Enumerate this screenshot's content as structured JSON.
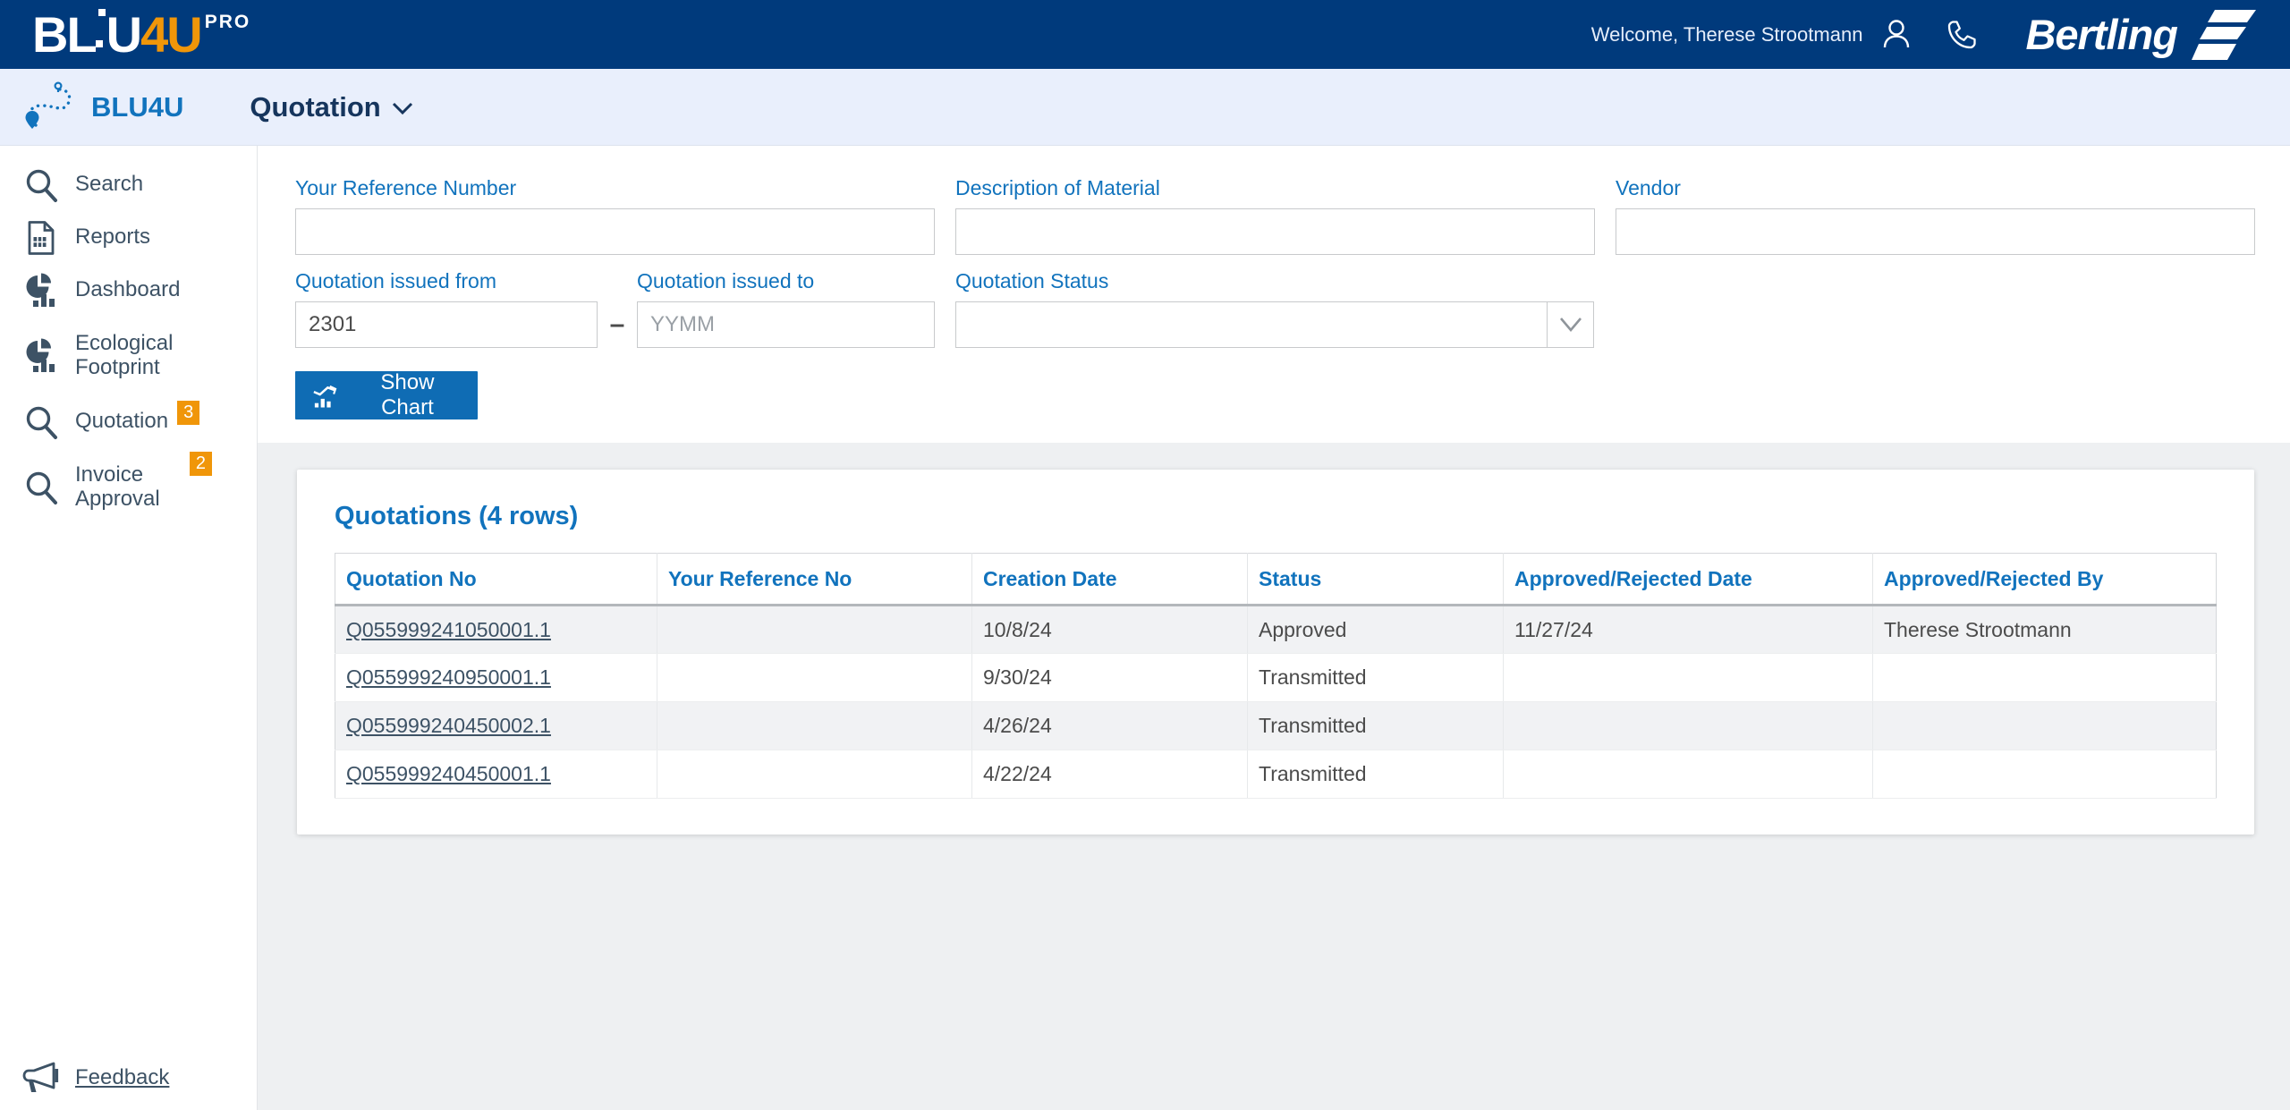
{
  "topbar": {
    "logo": {
      "white": "BL",
      "white2": "U",
      "orange": "4U",
      "suffix": "PRO"
    },
    "welcome": "Welcome, Therese Strootmann",
    "icons": [
      "user-icon",
      "phone-icon"
    ],
    "brand": "Bertling"
  },
  "subheader": {
    "app_name": "BLU4U",
    "nav": {
      "label": "Quotation"
    }
  },
  "sidebar": {
    "items": [
      {
        "label": "Search",
        "icon": "search-icon"
      },
      {
        "label": "Reports",
        "icon": "report-document-icon"
      },
      {
        "label": "Dashboard",
        "icon": "pie-bar-chart-icon"
      },
      {
        "label": "Ecological Footprint",
        "icon": "pie-bar-chart-icon"
      },
      {
        "label": "Quotation",
        "icon": "search-icon",
        "badge": "3"
      },
      {
        "label": "Invoice Approval",
        "icon": "search-icon",
        "badge": "2"
      }
    ],
    "feedback": {
      "label": "Feedback",
      "icon": "megaphone-icon"
    }
  },
  "filters": {
    "reference": {
      "label": "Your Reference Number",
      "value": ""
    },
    "material": {
      "label": "Description of Material",
      "value": ""
    },
    "vendor": {
      "label": "Vendor",
      "value": ""
    },
    "issued_from": {
      "label": "Quotation issued from",
      "value": "2301"
    },
    "issued_to": {
      "label": "Quotation issued to",
      "placeholder": "YYMM",
      "value": ""
    },
    "status": {
      "label": "Quotation Status",
      "value": ""
    },
    "range_separator": "–",
    "show_chart": "Show Chart"
  },
  "table": {
    "title": "Quotations (4 rows)",
    "columns": [
      "Quotation No",
      "Your Reference No",
      "Creation Date",
      "Status",
      "Approved/Rejected Date",
      "Approved/Rejected By"
    ],
    "rows": [
      {
        "quotation_no": "Q055999241050001.1",
        "your_reference_no": "",
        "creation_date": "10/8/24",
        "status": "Approved",
        "approved_rejected_date": "11/27/24",
        "approved_rejected_by": "Therese Strootmann"
      },
      {
        "quotation_no": "Q055999240950001.1",
        "your_reference_no": "",
        "creation_date": "9/30/24",
        "status": "Transmitted",
        "approved_rejected_date": "",
        "approved_rejected_by": ""
      },
      {
        "quotation_no": "Q055999240450002.1",
        "your_reference_no": "",
        "creation_date": "4/26/24",
        "status": "Transmitted",
        "approved_rejected_date": "",
        "approved_rejected_by": ""
      },
      {
        "quotation_no": "Q055999240450001.1",
        "your_reference_no": "",
        "creation_date": "4/22/24",
        "status": "Transmitted",
        "approved_rejected_date": "",
        "approved_rejected_by": ""
      }
    ]
  },
  "colors": {
    "topbar_navy": "#003a7c",
    "subheader_blue": "#e9effc",
    "accent_blue": "#1173bd",
    "nav_navy": "#16355d",
    "button_blue": "#0f6cb4",
    "badge_orange": "#f09609",
    "sidebar_slate": "#3d5265",
    "content_gray": "#eef0f2",
    "row_alt_gray": "#f1f2f4"
  }
}
